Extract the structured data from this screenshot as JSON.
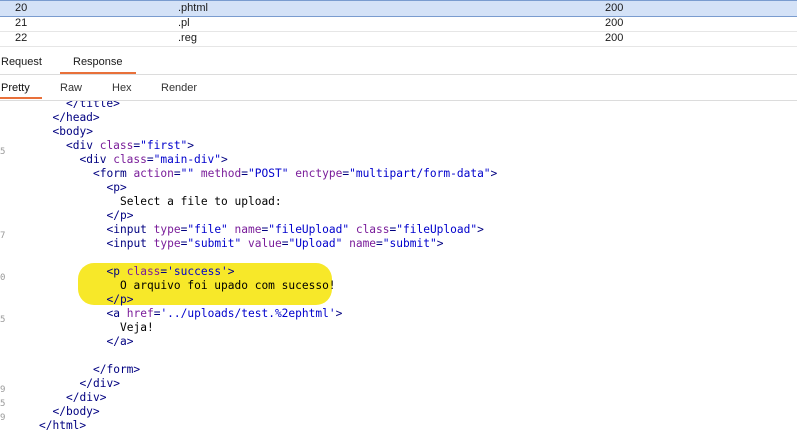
{
  "results": {
    "rows": [
      {
        "id": "20",
        "payload": ".phtml",
        "status": "200",
        "selected": true
      },
      {
        "id": "21",
        "payload": ".pl",
        "status": "200",
        "selected": false
      },
      {
        "id": "22",
        "payload": ".reg",
        "status": "200",
        "selected": false
      }
    ]
  },
  "tabs": {
    "request": "Request",
    "response": "Response",
    "active": "Response"
  },
  "subtabs": {
    "pretty": "Pretty",
    "raw": "Raw",
    "hex": "Hex",
    "render": "Render",
    "active": "Pretty"
  },
  "gutter_marks": [
    "5",
    "7",
    "0",
    "5",
    "9",
    "5",
    "9"
  ],
  "code_lines": [
    {
      "indent": 8,
      "text": "</title>"
    },
    {
      "indent": 6,
      "text": "</head>"
    },
    {
      "indent": 6,
      "text": "<body>"
    },
    {
      "indent": 8,
      "text": "<div class=\"first\">"
    },
    {
      "indent": 10,
      "text": "<div class=\"main-div\">"
    },
    {
      "indent": 12,
      "text": "<form action=\"\" method=\"POST\" enctype=\"multipart/form-data\">"
    },
    {
      "indent": 14,
      "text": "<p>"
    },
    {
      "indent": 16,
      "text": "Select a file to upload:"
    },
    {
      "indent": 14,
      "text": "</p>"
    },
    {
      "indent": 14,
      "text": "<input type=\"file\" name=\"fileUpload\" class=\"fileUpload\">"
    },
    {
      "indent": 14,
      "text": "<input type=\"submit\" value=\"Upload\" name=\"submit\">"
    },
    {
      "indent": 0,
      "text": ""
    },
    {
      "indent": 14,
      "text": "<p class='success'>"
    },
    {
      "indent": 16,
      "text": "O arquivo foi upado com sucesso!"
    },
    {
      "indent": 14,
      "text": "</p>"
    },
    {
      "indent": 14,
      "text": "<a href='../uploads/test.%2ephtml'>"
    },
    {
      "indent": 16,
      "text": "Veja!"
    },
    {
      "indent": 14,
      "text": "</a>"
    },
    {
      "indent": 0,
      "text": ""
    },
    {
      "indent": 12,
      "text": "</form>"
    },
    {
      "indent": 10,
      "text": "</div>"
    },
    {
      "indent": 8,
      "text": "</div>"
    },
    {
      "indent": 6,
      "text": "</body>"
    },
    {
      "indent": 4,
      "text": "</html>"
    }
  ],
  "colors": {
    "tag": "#000080",
    "attribute": "#7a1d9a",
    "value": "#0000cc",
    "highlight": "#f7e829",
    "tab_accent": "#e8703a",
    "selected_row": "#d4e2f7"
  }
}
